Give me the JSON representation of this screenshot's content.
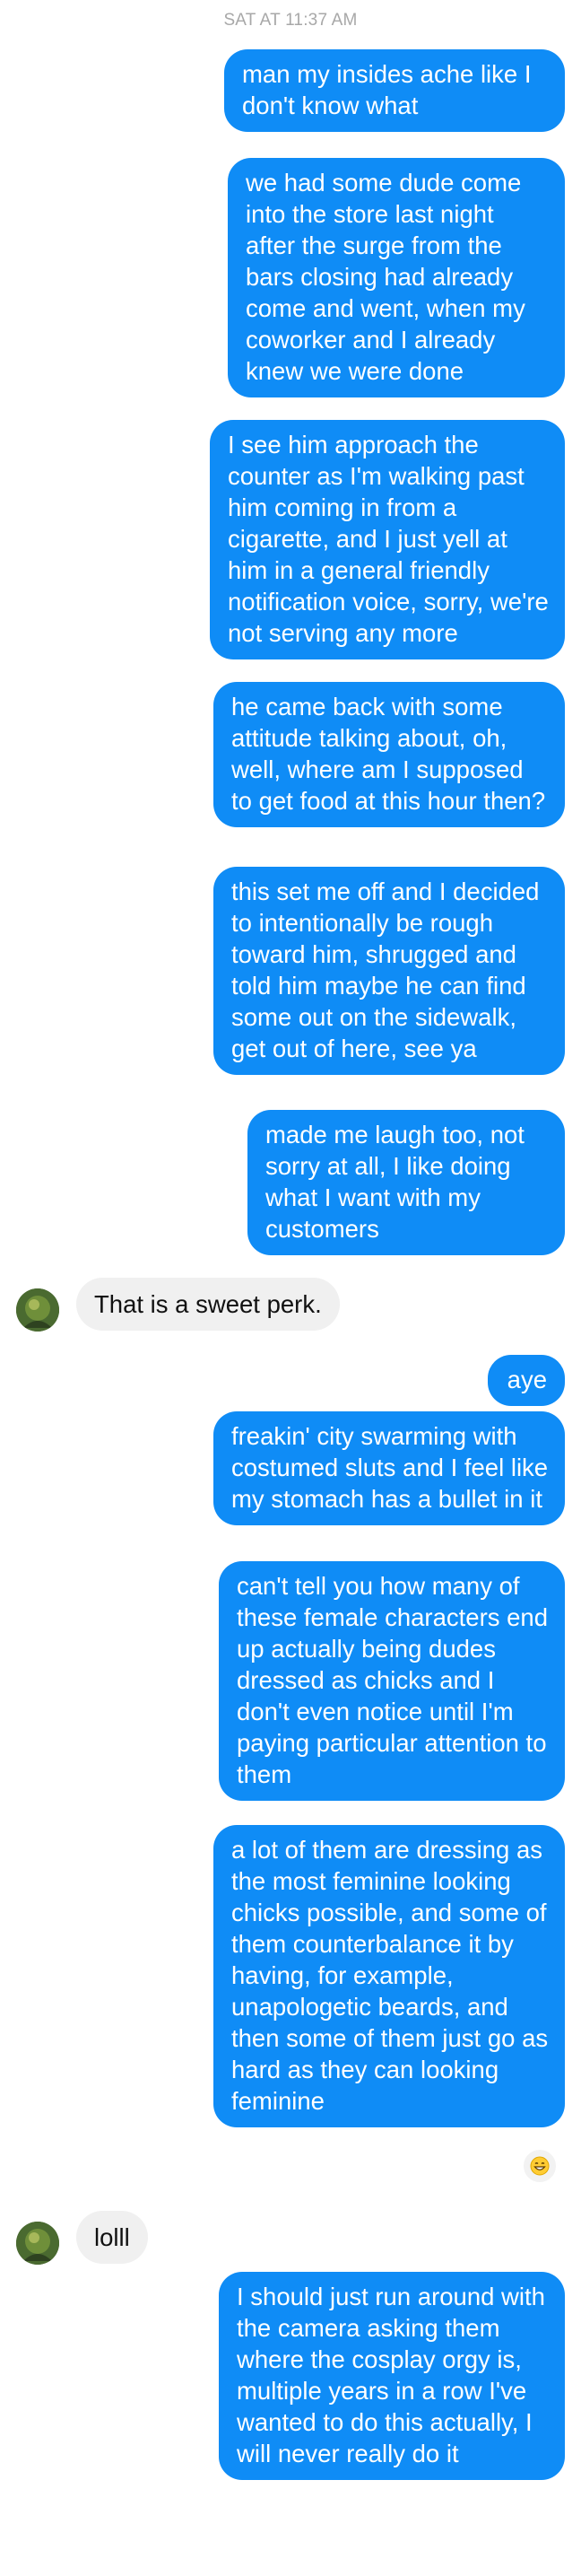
{
  "thread": {
    "timestamp": "SAT AT 11:37 AM"
  },
  "messages": [
    {
      "from": "me",
      "text": "man my insides ache like I don't know what"
    },
    {
      "from": "me",
      "text": "we had some dude come into the store last night after the surge from the bars closing had already come and went, when my coworker and I already knew we were done"
    },
    {
      "from": "me",
      "text": "I see him approach the counter as I'm walking past him coming in from a cigarette, and I just yell at him in a general friendly notification voice, sorry, we're not serving any more"
    },
    {
      "from": "me",
      "text": "he came back with some attitude talking about, oh, well, where am I supposed to get food at this hour then?"
    },
    {
      "from": "me",
      "text": "this set me off and I decided to intentionally be rough toward him, shrugged and told him maybe he can find some out on the sidewalk, get out of here, see ya"
    },
    {
      "from": "me",
      "text": "made me laugh too, not sorry at all, I like doing what I want with my customers"
    },
    {
      "from": "them",
      "text": "That is a sweet perk."
    },
    {
      "from": "me",
      "text": "aye"
    },
    {
      "from": "me",
      "text": "freakin' city swarming with costumed sluts and I feel like my stomach has a bullet in it"
    },
    {
      "from": "me",
      "text": "can't tell you how many of these female characters end up actually being dudes dressed as chicks and I don't even notice until I'm paying particular attention to them"
    },
    {
      "from": "me",
      "text": "a lot of them are dressing as the most feminine looking chicks possible, and some of them counterbalance it by having, for example, unapologetic beards, and then some of them just go as hard as they can looking feminine",
      "reaction": "grinning-face-icon"
    },
    {
      "from": "them",
      "text": "lolll"
    },
    {
      "from": "me",
      "text": "I should just run around with the camera asking them where the cosplay orgy is, multiple years in a row I've wanted to do this actually, I will never really do it"
    }
  ],
  "colors": {
    "outgoing_bubble": "#0f8cf6",
    "incoming_bubble": "#f0f0f0",
    "timestamp": "#a8a8a8"
  }
}
